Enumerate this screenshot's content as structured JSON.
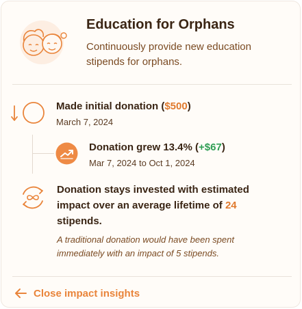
{
  "header": {
    "title": "Education for Orphans",
    "subtitle": "Continuously provide new education stipends for orphans.",
    "hero_icon": "children-faces-icon"
  },
  "timeline": {
    "initial": {
      "prefix": "Made initial donation (",
      "amount": "$500",
      "suffix": ")",
      "date": "March 7, 2024",
      "icon": "refresh-arrow-icon"
    },
    "growth": {
      "prefix": "Donation grew 13.4% (",
      "amount": "+$67",
      "suffix": ")",
      "date": "Mar 7, 2024 to Oct 1, 2024",
      "icon": "growth-chart-icon"
    },
    "impact": {
      "text_before": "Donation stays invested with estimated impact over an average lifetime of ",
      "stipends": "24",
      "text_after": " stipends.",
      "note": "A traditional donation would have been spent immediately with an impact of 5 stipends.",
      "icon": "infinity-cycle-icon"
    }
  },
  "footer": {
    "close_label": "Close impact insights",
    "icon": "arrow-left-icon"
  },
  "colors": {
    "accent": "#e9843a",
    "amount_orange": "#e07a2e",
    "amount_green": "#2f9e54",
    "title_text": "#3a2514",
    "body_text": "#7a4a22"
  }
}
